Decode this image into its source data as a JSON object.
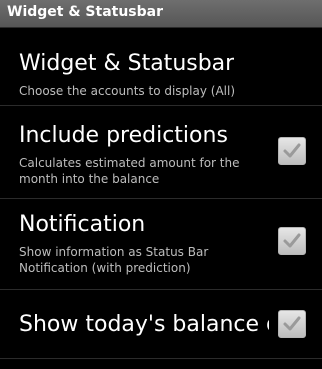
{
  "window": {
    "title": "Widget & Statusbar"
  },
  "preferences": [
    {
      "title": "Widget & Statusbar",
      "summary": "Choose the accounts to display (All)"
    },
    {
      "title": "Include predictions",
      "summary": "Calculates estimated amount for the month into the balance",
      "checked": true
    },
    {
      "title": "Notification",
      "summary": "Show information as Status Bar Notification (with prediction)",
      "checked": true
    },
    {
      "title": "Show today's balance on",
      "checked": true
    }
  ],
  "colors": {
    "background": "#000000",
    "titlebar": "#5f5f5f",
    "title_text": "#ffffff",
    "summary_text": "#bdbdbd",
    "checkbox": "#d0d0d0",
    "checkmark": "#9a9a9a"
  },
  "icons": {
    "checkbox": "checkmark-icon"
  }
}
